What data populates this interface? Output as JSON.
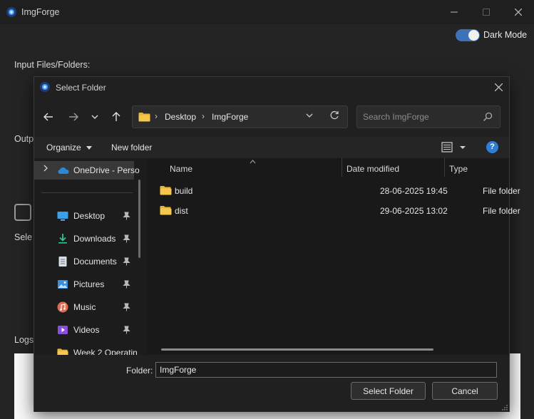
{
  "app": {
    "title": "ImgForge",
    "dark_mode": {
      "label": "Dark Mode",
      "enabled": true
    },
    "labels": {
      "input": "Input Files/Folders:",
      "output": "Outp",
      "select": "Sele",
      "logs": "Logs"
    }
  },
  "dialog": {
    "title": "Select Folder",
    "nav": {
      "breadcrumbs": [
        "Desktop",
        "ImgForge"
      ],
      "search_placeholder": "Search ImgForge"
    },
    "commands": {
      "organize": "Organize",
      "new_folder": "New folder",
      "help": "?"
    },
    "nav_pane": {
      "onedrive": "OneDrive - Perso",
      "quick_access": [
        {
          "label": "Desktop",
          "icon": "desktop-icon",
          "pinned": true
        },
        {
          "label": "Downloads",
          "icon": "downloads-icon",
          "pinned": true
        },
        {
          "label": "Documents",
          "icon": "documents-icon",
          "pinned": true
        },
        {
          "label": "Pictures",
          "icon": "pictures-icon",
          "pinned": true
        },
        {
          "label": "Music",
          "icon": "music-icon",
          "pinned": true
        },
        {
          "label": "Videos",
          "icon": "videos-icon",
          "pinned": true
        },
        {
          "label": "Week 2 Operatin",
          "icon": "folder-icon",
          "pinned": false
        }
      ]
    },
    "columns": {
      "name": "Name",
      "date_modified": "Date modified",
      "type": "Type"
    },
    "files": [
      {
        "name": "build",
        "date": "28-06-2025 19:45",
        "type": "File folder"
      },
      {
        "name": "dist",
        "date": "29-06-2025 13:02",
        "type": "File folder"
      }
    ],
    "footer": {
      "folder_label": "Folder:",
      "folder_value": "ImgForge",
      "select_button": "Select Folder",
      "cancel_button": "Cancel"
    }
  },
  "colors": {
    "accent": "#3d72b9",
    "folder": "#e8b339",
    "help": "#2f7fd6"
  }
}
